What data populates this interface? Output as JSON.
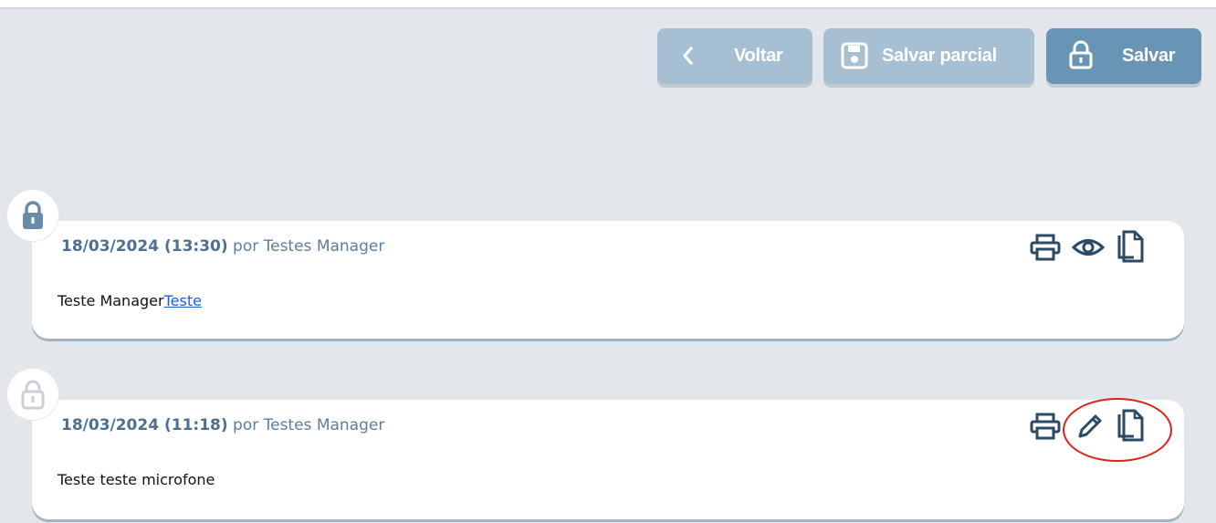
{
  "toolbar": {
    "back_label": "Voltar",
    "save_partial_label": "Salvar parcial",
    "save_label": "Salvar"
  },
  "entries": [
    {
      "date": "18/03/2024 (13:30)",
      "author_text": "por Testes Manager",
      "body_text": "Teste Manager",
      "body_link": "Teste",
      "locked": true,
      "actions": [
        "print-icon",
        "view-icon",
        "copy-icon"
      ]
    },
    {
      "date": "18/03/2024 (11:18)",
      "author_text": "por Testes Manager",
      "body_text": "Teste teste microfone",
      "locked": false,
      "actions": [
        "print-icon",
        "edit-icon",
        "copy-icon"
      ]
    }
  ],
  "colors": {
    "accent_light": "#a6bfd2",
    "accent": "#6894b5",
    "highlight": "#e0211a",
    "background": "#e3e6ea"
  }
}
